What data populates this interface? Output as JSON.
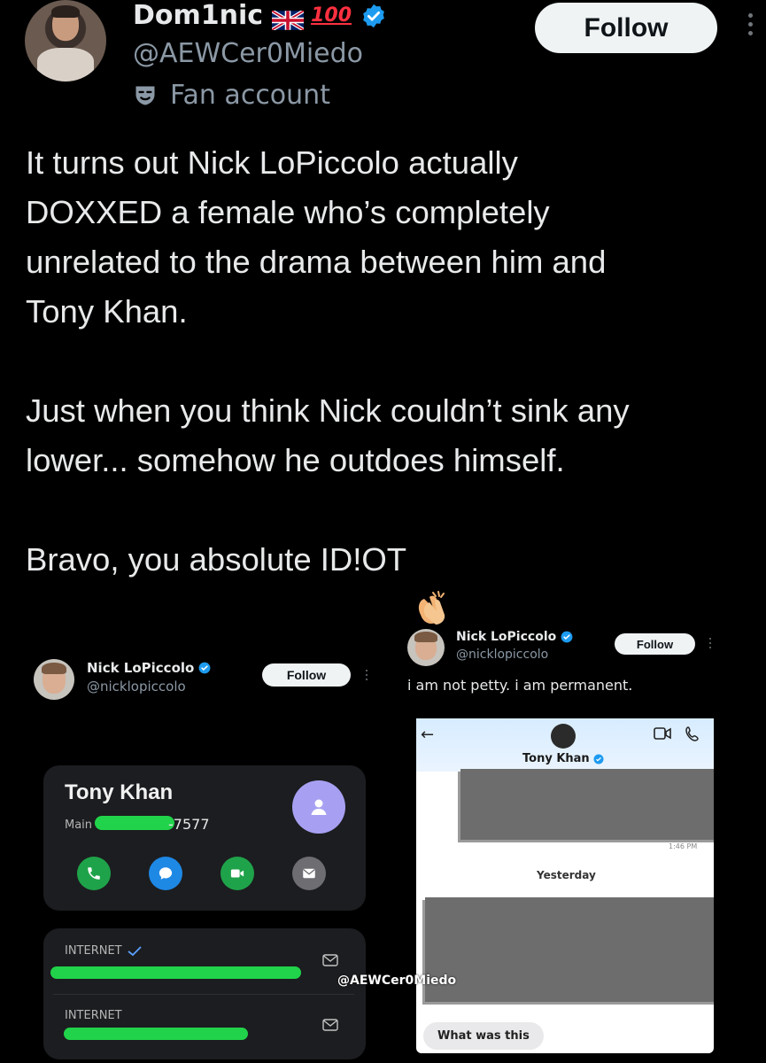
{
  "tweet": {
    "display_name": "Dom1nic",
    "flag_emoji": "uk-flag",
    "hundred_emoji": "100",
    "handle": "@AEWCer0Miedo",
    "label": "Fan account",
    "follow_label": "Follow",
    "paragraphs": [
      "It turns out Nick LoPiccolo actually\nDOXXED a female who’s completely\nunrelated to the drama between him and\nTony Khan.",
      "Just when you think Nick couldn’t sink any\nlower... somehow he outdoes himself.",
      "Bravo, you absolute ID!OT"
    ],
    "trailing_emoji": "clapping-hands"
  },
  "left_embed": {
    "name": "Nick LoPiccolo",
    "handle": "@nicklopiccolo",
    "follow_label": "Follow",
    "contact": {
      "name": "Tony Khan",
      "main_label": "Main",
      "number_suffix": "-7577",
      "actions": [
        "phone-icon",
        "message-icon",
        "video-icon",
        "mail-icon"
      ]
    },
    "internet_rows": [
      {
        "label": "INTERNET",
        "checked": true
      },
      {
        "label": "INTERNET",
        "checked": false
      }
    ]
  },
  "right_embed": {
    "name": "Nick LoPiccolo",
    "handle": "@nicklopiccolo",
    "follow_label": "Follow",
    "text": "i am not petty. i am permanent.",
    "chat": {
      "back": "←",
      "contact_name": "Tony Khan",
      "divider": "Yesterday",
      "time": "1:46 PM",
      "bubble": "What was this"
    }
  },
  "watermark": "@AEWCer0Miedo",
  "colors": {
    "background": "#000000",
    "text": "#e7e9ea",
    "secondary": "#8b98a5",
    "verified": "#1d9bf0",
    "redaction_green": "#21d34a",
    "redaction_gray": "#6d6d6d"
  }
}
